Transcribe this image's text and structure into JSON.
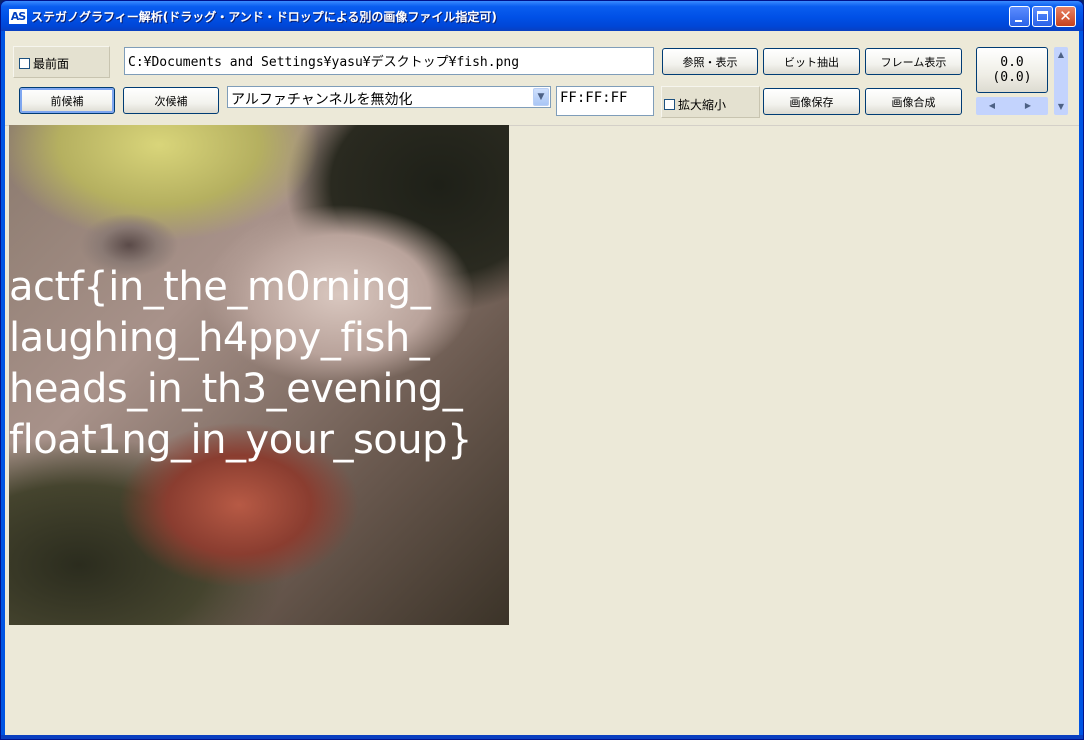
{
  "window": {
    "icon_text": "AS",
    "title": "ステガノグラフィー解析(ドラッグ・アンド・ドロップによる別の画像ファイル指定可)"
  },
  "toolbar": {
    "topmost_label": "最前面",
    "topmost_checked": false,
    "path_value": "C:¥Documents and Settings¥yasu¥デスクトップ¥fish.png",
    "browse_label": "参照・表示",
    "bit_extract_label": "ビット抽出",
    "frame_label": "フレーム表示",
    "prev_label": "前候補",
    "next_label": "次候補",
    "mode_select_value": "アルファチャンネルを無効化",
    "color_value": "FF:FF:FF",
    "zoom_label": "拡大縮小",
    "zoom_checked": false,
    "save_label": "画像保存",
    "combine_label": "画像合成",
    "coord_line1": "0.0",
    "coord_line2": "(0.0)"
  },
  "image": {
    "overlay_text": "actf{in_the_m0rning_\nlaughing_h4ppy_fish_\nheads_in_th3_evening_\nfloat1ng_in_your_soup}"
  },
  "colors": {
    "title_bar": "#0054e3",
    "client_bg": "#ece9d8",
    "text_overlay": "#ffffff"
  }
}
